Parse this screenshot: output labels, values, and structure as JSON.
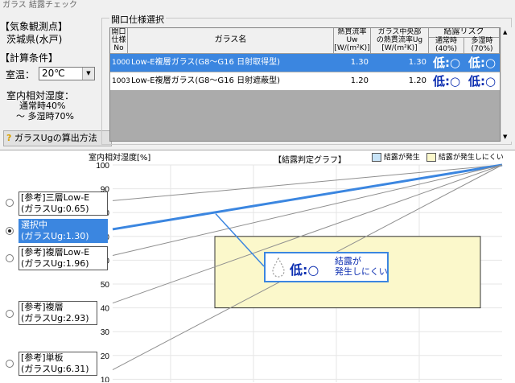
{
  "window": {
    "title": "ガラス 結露チェック"
  },
  "left": {
    "station_header": "【気象観測点】",
    "station": "茨城県(水戸)",
    "calc_header": "【計算条件】",
    "room_temp_label": "室温：",
    "room_temp_value": "20℃",
    "humidity_label": "室内相対湿度：",
    "humidity_normal": "通常時40%",
    "humidity_high": "～ 多湿時70%",
    "calc_button": "ガラスUgの算出方法"
  },
  "spec": {
    "group_label": "開口仕様選択",
    "headers": {
      "no": [
        "開口",
        "仕様",
        "No"
      ],
      "glass": "ガラス名",
      "uw": [
        "熱貫流率",
        "Uw",
        "[W/(m²K)]"
      ],
      "ug": [
        "ガラス中央部",
        "の熱貫流率Ug",
        "[W/(m²K)]"
      ],
      "risk": "結露リスク",
      "risk_normal": [
        "通常時",
        "(40%)"
      ],
      "risk_high": [
        "多湿時",
        "(70%)"
      ]
    },
    "rows": [
      {
        "no": "1000",
        "glass": "Low-E複層ガラス(G8～G16 日射取得型)",
        "uw": "1.30",
        "ug": "1.30",
        "risk_normal": "低:○",
        "risk_high": "低:○"
      },
      {
        "no": "1003",
        "glass": "Low-E複層ガラス(G8～G16 日射遮蔽型)",
        "uw": "1.20",
        "ug": "1.20",
        "risk_normal": "低:○",
        "risk_high": "低:○"
      }
    ]
  },
  "chart": {
    "ylabel": "室内相対湿度[%]",
    "title": "【結露判定グラフ】",
    "legend_condense": "結露が発生",
    "legend_safe": "結露が発生しにくい",
    "callout_risk": "低:○",
    "callout_text1": "結露が",
    "callout_text2": "発生しにくい",
    "ticks": [
      "100",
      "90",
      "80",
      "70",
      "60",
      "50",
      "40",
      "30",
      "20",
      "10"
    ],
    "options": [
      {
        "line1": "[参考]三層Low-E",
        "line2": "(ガラスUg:0.65)"
      },
      {
        "line1": "選択中",
        "line2": "(ガラスUg:1.30)"
      },
      {
        "line1": "[参考]複層Low-E",
        "line2": "(ガラスUg:1.96)"
      },
      {
        "line1": "[参考]複層",
        "line2": "(ガラスUg:2.93)"
      },
      {
        "line1": "[参考]単板",
        "line2": "(ガラスUg:6.31)"
      }
    ]
  },
  "chart_data": {
    "type": "line",
    "ylabel": "室内相対湿度[%]",
    "title": "【結露判定グラフ】",
    "ylim": [
      10,
      100
    ],
    "yticks": [
      100,
      90,
      80,
      70,
      60,
      50,
      40,
      30,
      20,
      10
    ],
    "region": {
      "name": "結露が発生しにくい",
      "y_range": [
        40,
        70
      ]
    },
    "series": [
      {
        "name": "[参考]三層Low-E (ガラスUg:0.65)",
        "values": [
          85,
          100
        ]
      },
      {
        "name": "選択中 (ガラスUg:1.30)",
        "values": [
          73,
          100
        ]
      },
      {
        "name": "[参考]複層Low-E (ガラスUg:1.96)",
        "values": [
          62,
          100
        ]
      },
      {
        "name": "[参考]複層 (ガラスUg:2.93)",
        "values": [
          42,
          100
        ]
      },
      {
        "name": "[参考]単板 (ガラスUg:6.31)",
        "values": [
          14,
          100
        ]
      }
    ]
  },
  "colors": {
    "selected": "#3b86e0",
    "safe_fill": "#fbf8cb",
    "condense_fill": "#c8e4f8"
  }
}
